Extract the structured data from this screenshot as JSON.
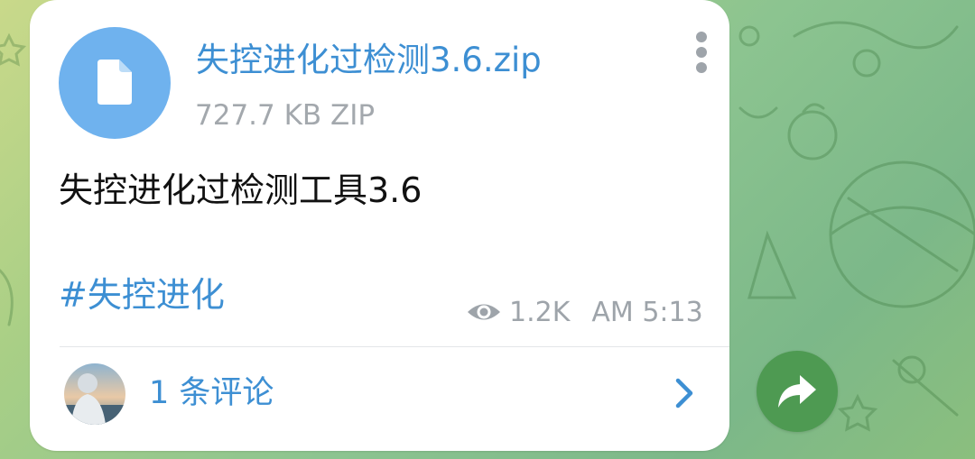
{
  "message": {
    "file": {
      "name": "失控进化过检测3.6.zip",
      "size": "727.7 KB ZIP",
      "icon": "document-icon"
    },
    "caption": "失控进化过检测工具3.6",
    "hashtag": "#失控进化",
    "views": "1.2K",
    "time": "AM 5:13",
    "comments": {
      "label": "1 条评论"
    }
  },
  "colors": {
    "accent": "#3d8fd3",
    "file_icon_bg": "#6fb2ee",
    "share_button_bg": "#4e9a52",
    "meta_text": "#9ea4aa"
  },
  "icons": [
    "document-icon",
    "more-vertical-icon",
    "eye-icon",
    "chevron-right-icon",
    "share-icon"
  ]
}
